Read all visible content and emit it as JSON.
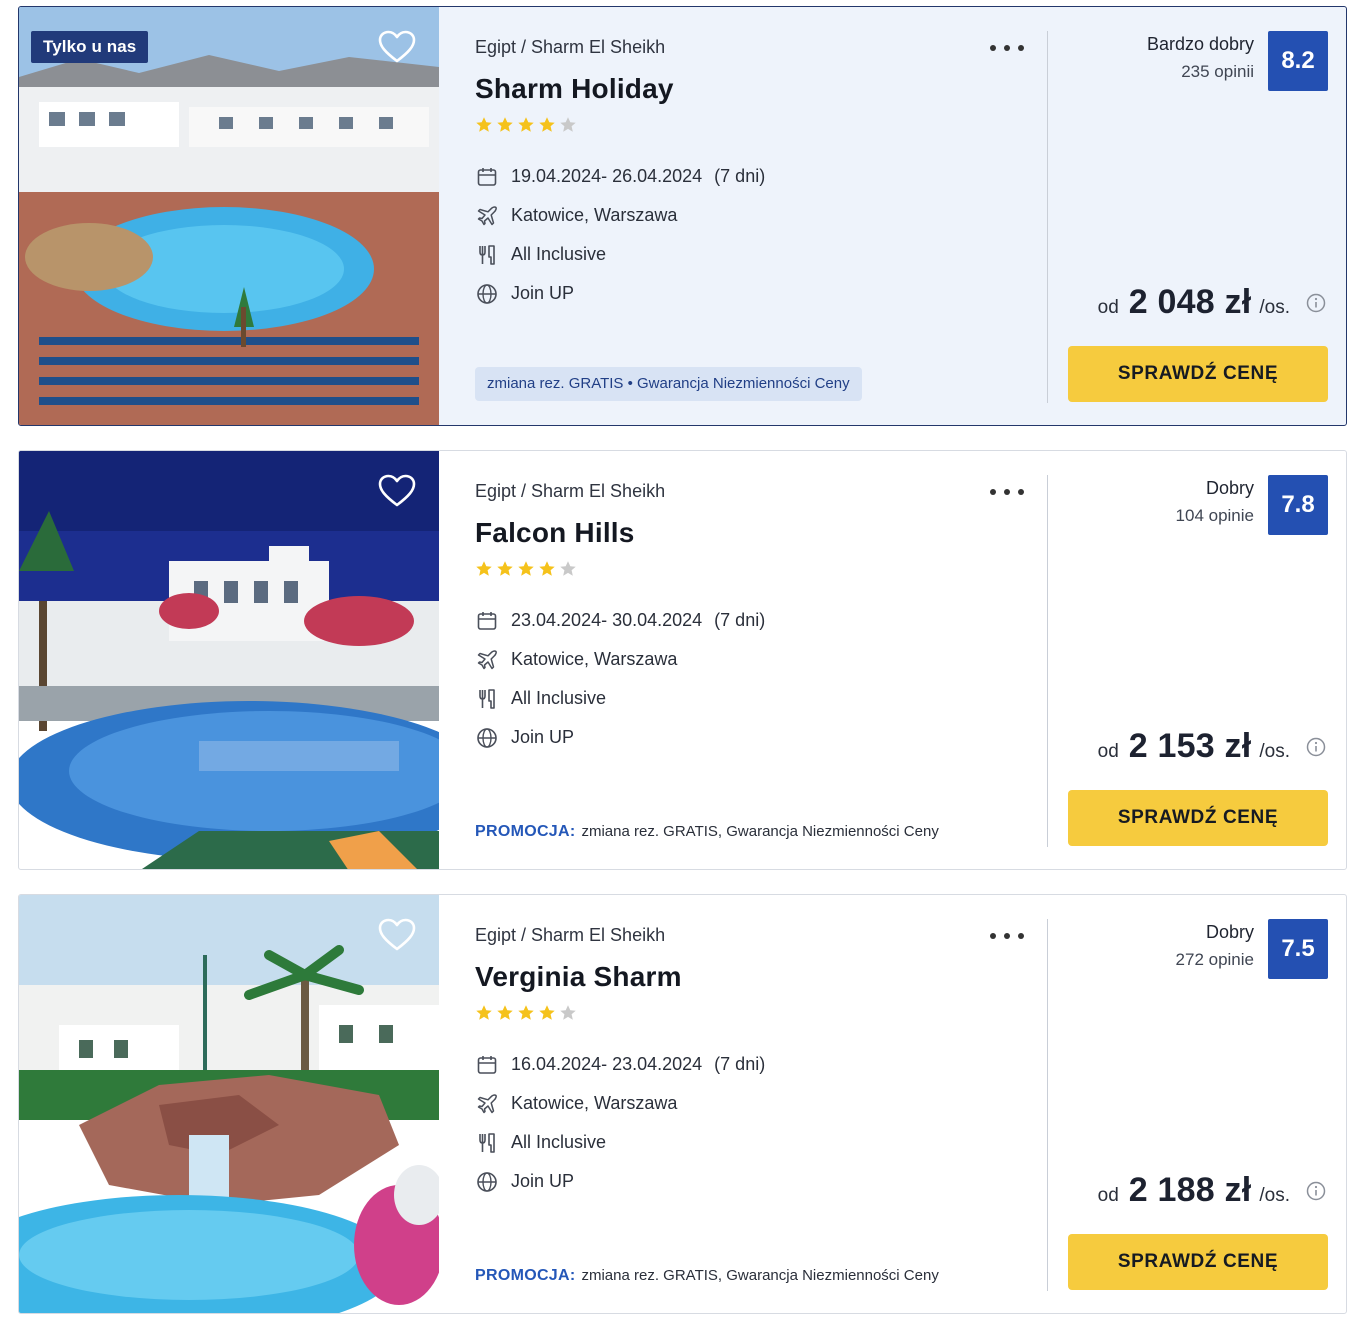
{
  "offers": [
    {
      "badge": "Tylko u nas",
      "location": "Egipt / Sharm El Sheikh",
      "name": "Sharm Holiday",
      "stars": 4,
      "dates": "19.04.2024- 26.04.2024",
      "duration": "(7 dni)",
      "departure": "Katowice, Warszawa",
      "board": "All Inclusive",
      "operator": "Join UP",
      "tags": "zmiana rez. GRATIS • Gwarancja Niezmienności Ceny",
      "rating_label": "Bardzo dobry",
      "rating_count": "235 opinii",
      "score": "8.2",
      "price_prefix": "od",
      "price": "2 048 zł",
      "price_unit": "/os.",
      "cta": "SPRAWDŹ CENĘ"
    },
    {
      "location": "Egipt / Sharm El Sheikh",
      "name": "Falcon Hills",
      "stars": 4,
      "dates": "23.04.2024- 30.04.2024",
      "duration": "(7 dni)",
      "departure": "Katowice, Warszawa",
      "board": "All Inclusive",
      "operator": "Join UP",
      "promo_label": "PROMOCJA:",
      "promo_text": "zmiana rez. GRATIS, Gwarancja Niezmienności Ceny",
      "rating_label": "Dobry",
      "rating_count": "104 opinie",
      "score": "7.8",
      "price_prefix": "od",
      "price": "2 153 zł",
      "price_unit": "/os.",
      "cta": "SPRAWDŹ CENĘ"
    },
    {
      "location": "Egipt / Sharm El Sheikh",
      "name": "Verginia Sharm",
      "stars": 4,
      "dates": "16.04.2024- 23.04.2024",
      "duration": "(7 dni)",
      "departure": "Katowice, Warszawa",
      "board": "All Inclusive",
      "operator": "Join UP",
      "promo_label": "PROMOCJA:",
      "promo_text": "zmiana rez. GRATIS, Gwarancja Niezmienności Ceny",
      "rating_label": "Dobry",
      "rating_count": "272 opinie",
      "score": "7.5",
      "price_prefix": "od",
      "price": "2 188 zł",
      "price_unit": "/os.",
      "cta": "SPRAWDŹ CENĘ"
    }
  ],
  "colors": {
    "accent_navy": "#213a7a",
    "score_blue": "#2450b2",
    "cta_yellow": "#f6cb3e",
    "star_filled": "#f5c21b",
    "star_empty": "#c9c9c9",
    "promo_blue": "#2457b8",
    "highlight_bg": "#eef3fb"
  },
  "icons": {
    "favorite": "heart-outline-icon",
    "more": "more-horizontal-icon",
    "dates": "calendar-icon",
    "departure": "plane-icon",
    "board": "cutlery-icon",
    "operator": "globe-icon",
    "price_info": "info-circle-icon",
    "rating": "star-icon"
  }
}
